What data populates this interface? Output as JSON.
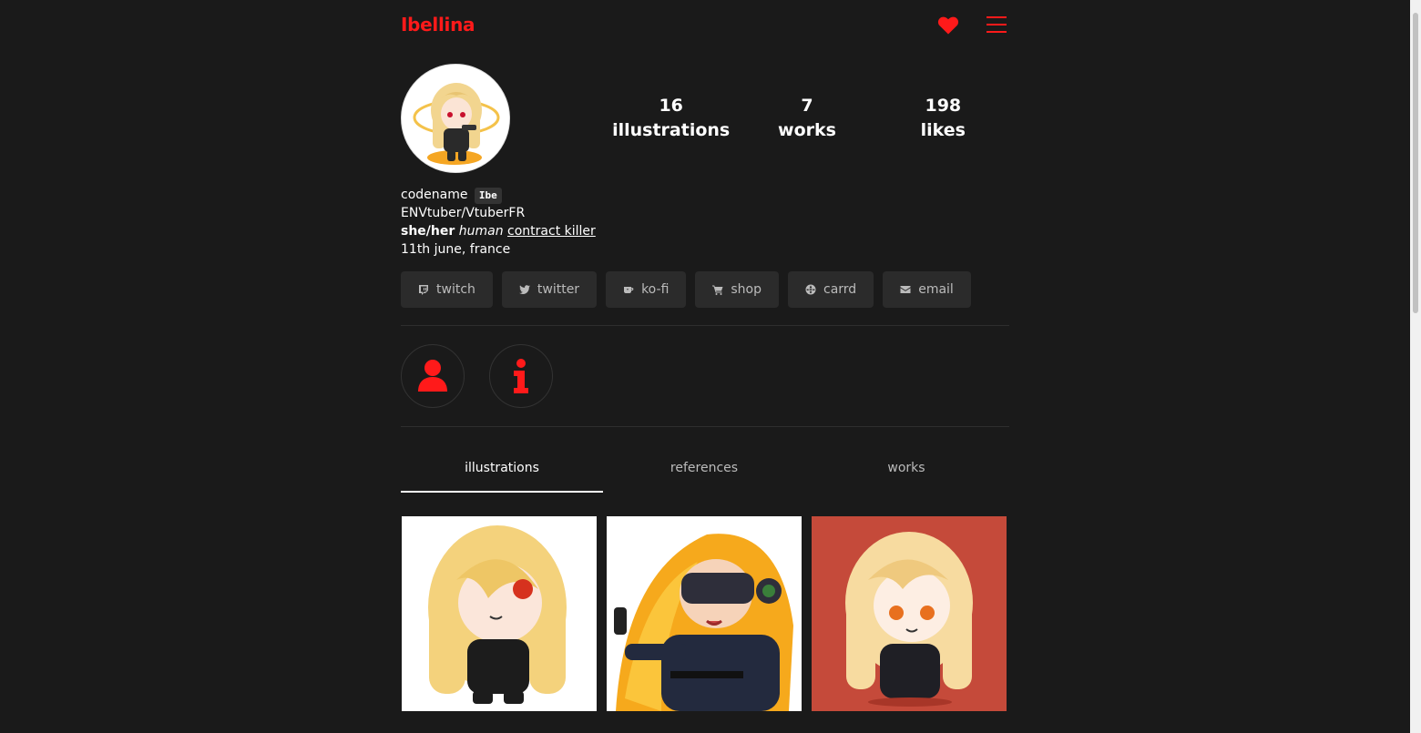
{
  "header": {
    "brand": "Ibellina"
  },
  "stats": [
    {
      "value": "16",
      "label": "illustrations"
    },
    {
      "value": "7",
      "label": "works"
    },
    {
      "value": "198",
      "label": "likes"
    }
  ],
  "bio": {
    "codename_label": "codename",
    "codename_tag": "Ibe",
    "line2": "ENVtuber/VtuberFR",
    "pronouns": "she/her",
    "species": "human",
    "role": "contract killer",
    "birthday": "11th june, france"
  },
  "links": [
    {
      "label": "twitch",
      "icon": "twitch-icon"
    },
    {
      "label": "twitter",
      "icon": "twitter-icon"
    },
    {
      "label": "ko-fi",
      "icon": "kofi-cup-icon"
    },
    {
      "label": "shop",
      "icon": "cart-icon"
    },
    {
      "label": "carrd",
      "icon": "globe-icon"
    },
    {
      "label": "email",
      "icon": "envelope-icon"
    }
  ],
  "tabs": [
    {
      "label": "illustrations",
      "active": true
    },
    {
      "label": "references",
      "active": false
    },
    {
      "label": "works",
      "active": false
    }
  ],
  "colors": {
    "background": "#1a1a1a",
    "accent": "#ff1a1a",
    "button_bg": "#2b2b2b"
  }
}
